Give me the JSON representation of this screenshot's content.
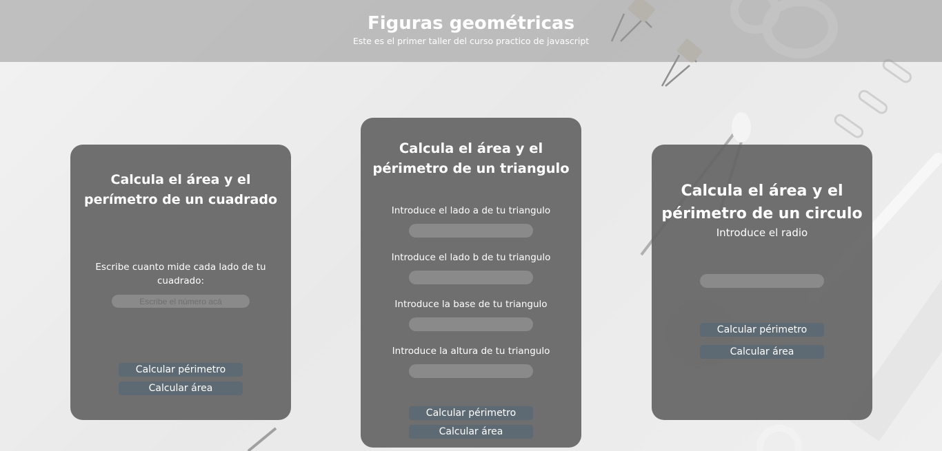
{
  "header": {
    "title": "Figuras geométricas",
    "subtitle": "Este es el primer taller del curso practico de javascript"
  },
  "square": {
    "title": "Calcula el área y el perímetro de un cuadrado",
    "side_label": "Escribe cuanto mide cada lado de tu cuadrado:",
    "side_placeholder": "Escribe el número acá",
    "perimeter_button": "Calcular périmetro",
    "area_button": "Calcular área"
  },
  "triangle": {
    "title": "Calcula el área y el périmetro de un triangulo",
    "fields": [
      {
        "label": "Introduce el lado a de tu triangulo",
        "placeholder": ""
      },
      {
        "label": "Introduce el lado b de tu triangulo",
        "placeholder": ""
      },
      {
        "label": "Introduce la base de tu triangulo",
        "placeholder": ""
      },
      {
        "label": "Introduce la altura de tu triangulo",
        "placeholder": ""
      }
    ],
    "perimeter_button": "Calcular périmetro",
    "area_button": "Calcular área"
  },
  "circle": {
    "title": "Calcula el área y el périmetro de un circulo",
    "radius_label": "Introduce el radio",
    "radius_placeholder": "",
    "perimeter_button": "Calcular périmetro",
    "area_button": "Calcular área"
  },
  "colors": {
    "card": "#646464",
    "button": "#5d6a74",
    "input": "#8a8a8a",
    "header": "#a3a3a3"
  }
}
